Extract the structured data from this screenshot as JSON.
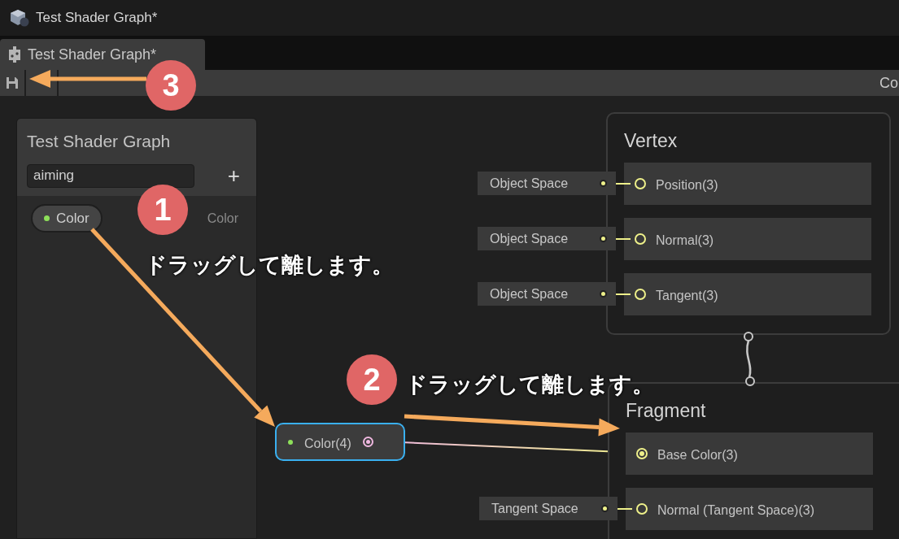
{
  "window": {
    "title": "Test Shader Graph*"
  },
  "tabs": [
    {
      "label": "Test Shader Graph*",
      "selected": true
    }
  ],
  "toolbar": {
    "right_text": "Co"
  },
  "blackboard": {
    "title": "Test Shader Graph",
    "field": {
      "value": "aiming"
    },
    "add_label": "+",
    "properties": [
      {
        "name": "Color",
        "type_label": "Color",
        "color": "#8ee05a"
      }
    ]
  },
  "nodes": [
    {
      "title": "Color(4)",
      "selected": true
    }
  ],
  "contexts": [
    {
      "title": "Vertex",
      "slots": [
        {
          "label": "Position(3)",
          "input": "Object Space",
          "connected": false
        },
        {
          "label": "Normal(3)",
          "input": "Object Space",
          "connected": false
        },
        {
          "label": "Tangent(3)",
          "input": "Object Space",
          "connected": false
        }
      ]
    },
    {
      "title": "Fragment",
      "slots": [
        {
          "label": "Base Color(3)",
          "connected": true
        },
        {
          "label": "Normal (Tangent Space)(3)",
          "input": "Tangent Space",
          "connected": false
        }
      ]
    }
  ],
  "annotations": [
    {
      "number": "1",
      "text": "ドラッグして離します。"
    },
    {
      "number": "2",
      "text": "ドラッグして離します。"
    },
    {
      "number": "3"
    }
  ]
}
